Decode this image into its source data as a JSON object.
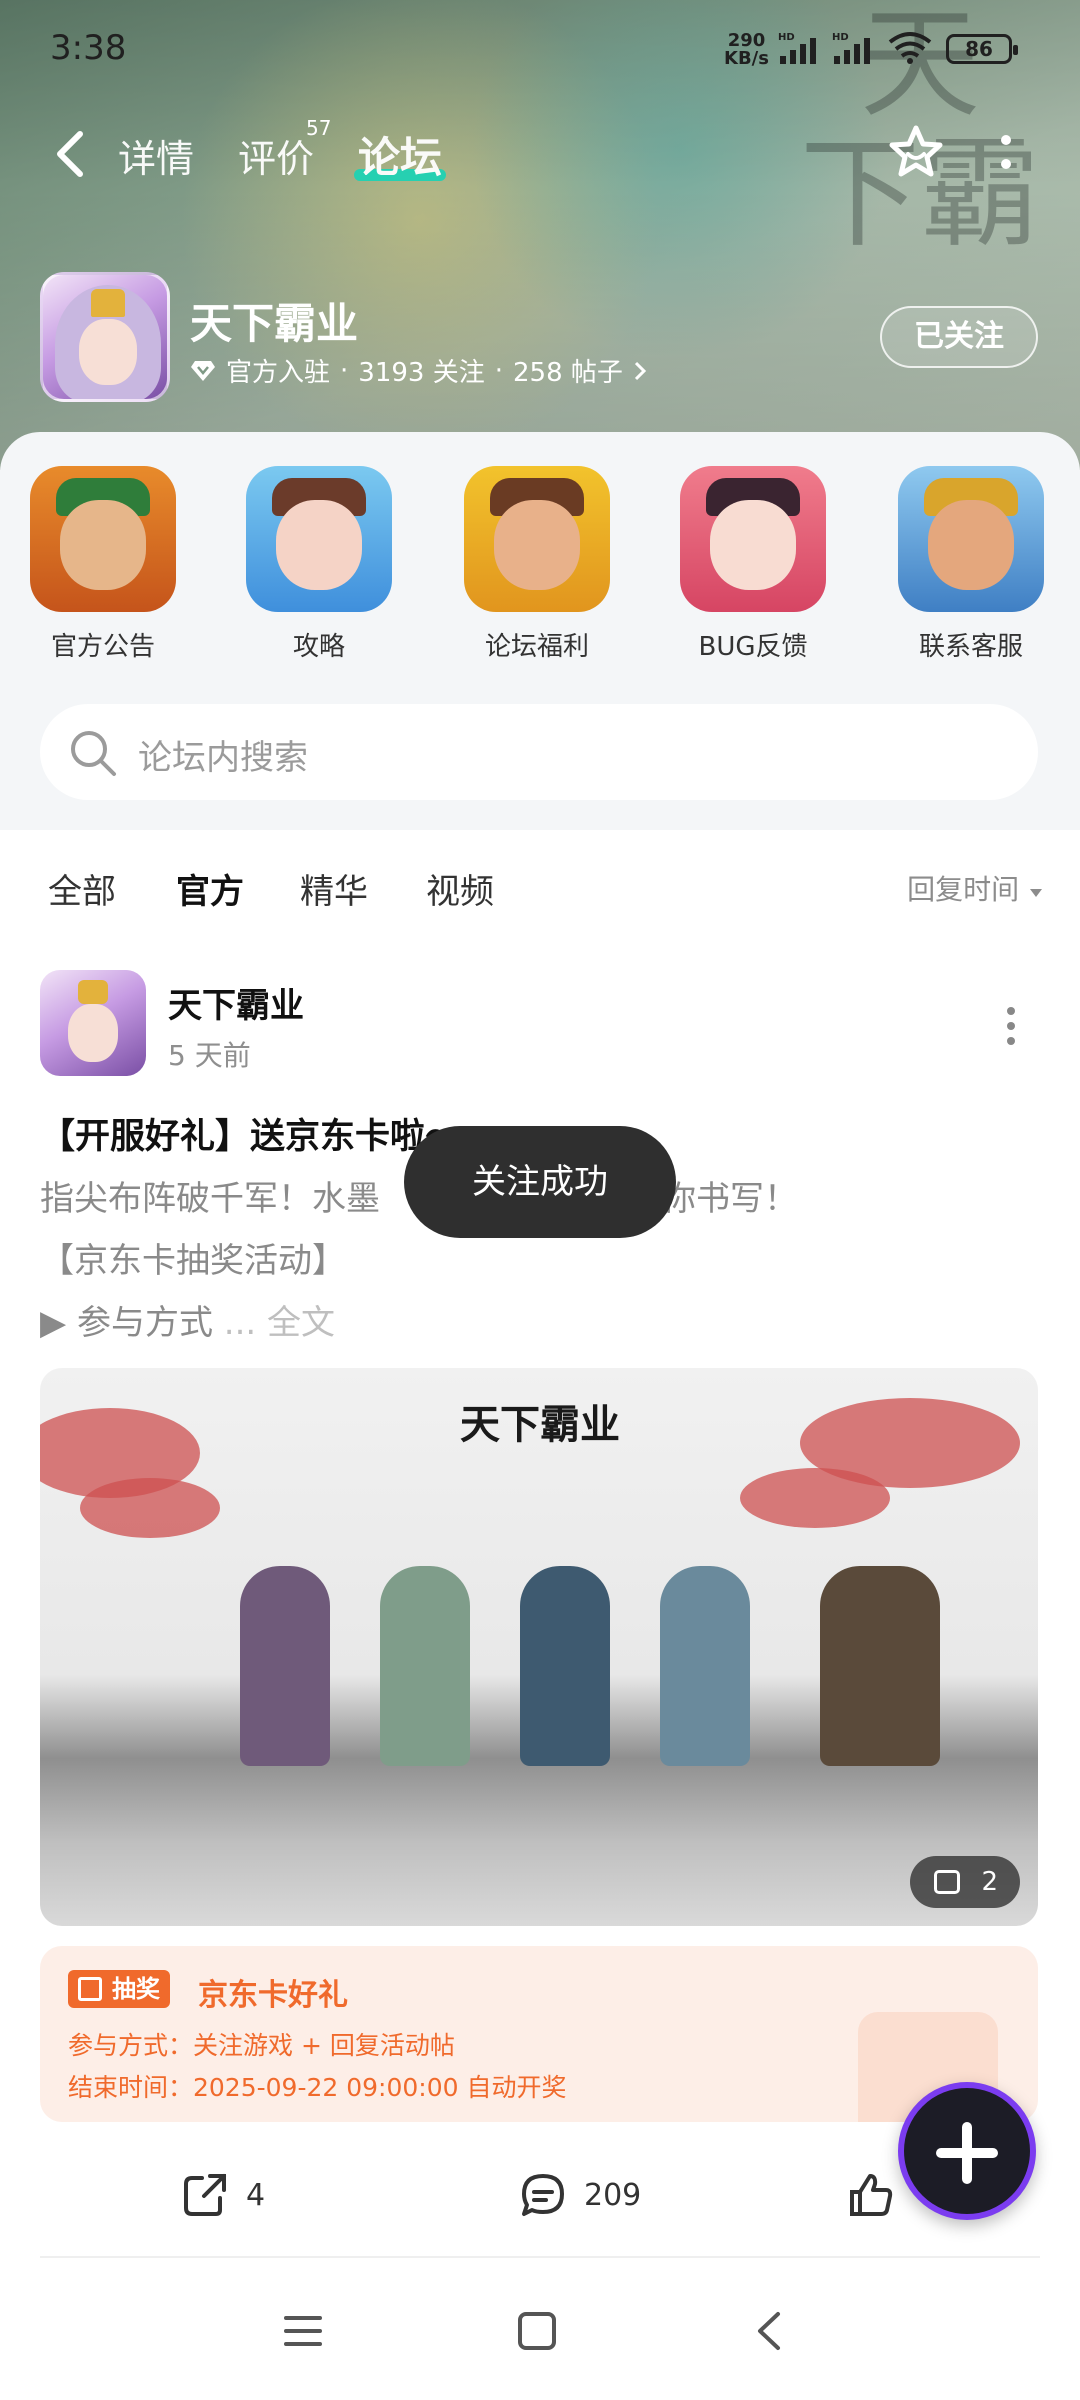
{
  "status_bar": {
    "time": "3:38",
    "net_speed": "290",
    "net_unit": "KB/s",
    "battery": "86"
  },
  "nav": {
    "tabs": [
      {
        "label": "详情"
      },
      {
        "label": "评价",
        "badge": "57"
      },
      {
        "label": "论坛"
      }
    ],
    "active_tab": "论坛"
  },
  "game": {
    "title": "天下霸业",
    "badge": "官方入驻",
    "followers": "3193 关注",
    "posts": "258 帖子",
    "follow_button": "已关注",
    "background_calligraphy": "天下霸业"
  },
  "quick_links": [
    {
      "label": "官方公告"
    },
    {
      "label": "攻略"
    },
    {
      "label": "论坛福利"
    },
    {
      "label": "BUG反馈"
    },
    {
      "label": "联系客服"
    }
  ],
  "search": {
    "placeholder": "论坛内搜索"
  },
  "filters": {
    "tabs": [
      "全部",
      "官方",
      "精华",
      "视频"
    ],
    "active": "官方",
    "sort_label": "回复时间"
  },
  "post": {
    "author": "天下霸业",
    "time": "5 天前",
    "title": "【开服好礼】送京东卡啦～",
    "body_line1": "指尖布阵破千军！水墨",
    "body_line1_end": "由你书写！",
    "body_line2": "【京东卡抽奖活动】",
    "body_line3": "▶ 参与方式",
    "more_text": " ... 全文",
    "image_logo": "天下霸业",
    "image_count": "2",
    "lottery": {
      "tag": "抽奖",
      "title": "京东卡好礼",
      "method": "参与方式：关注游戏 + 回复活动帖",
      "end_time": "结束时间：2025-09-22 09:00:00 自动开奖"
    },
    "shares": "4",
    "comments": "209"
  },
  "toast": "关注成功",
  "colors": {
    "accent": "#1fd2b4",
    "lottery": "#f06a2c",
    "fab_ring": "#7b3cf0"
  }
}
